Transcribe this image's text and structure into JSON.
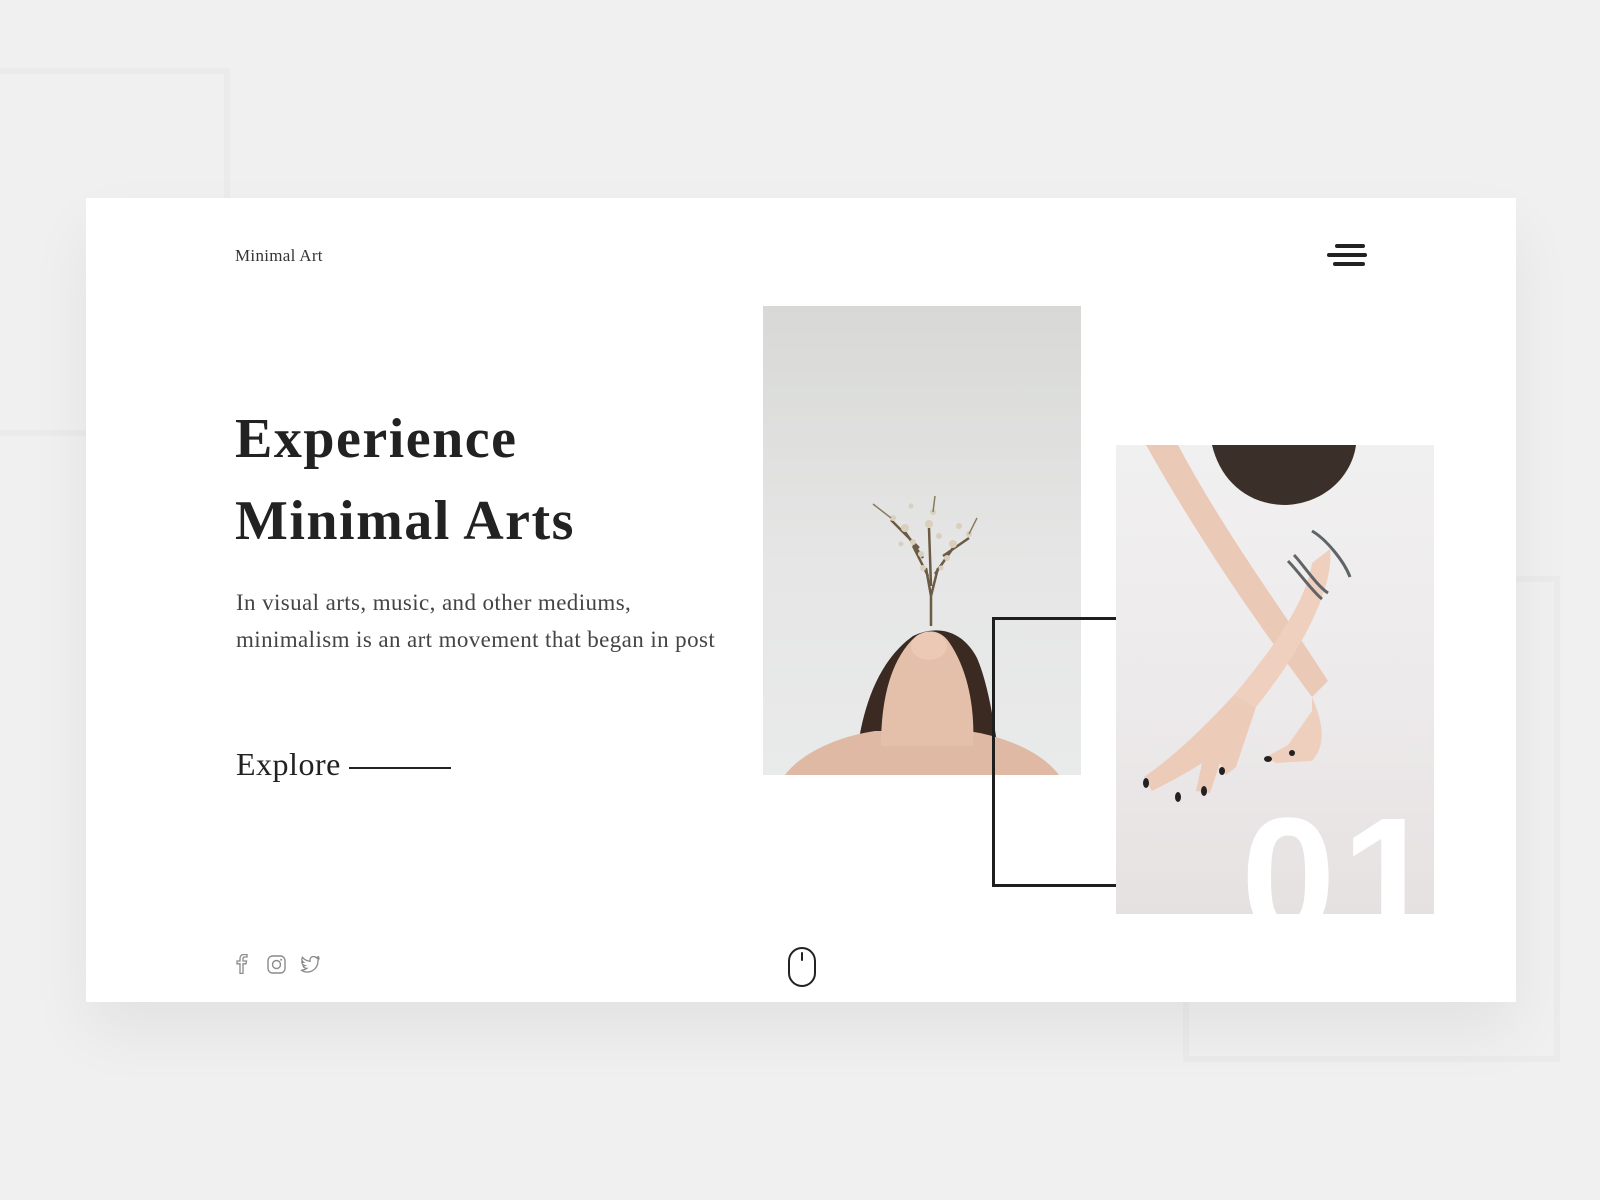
{
  "header": {
    "brand": "Minimal Art"
  },
  "hero": {
    "headline_line1": "Experience",
    "headline_line2": "Minimal Arts",
    "description": "In visual arts, music, and other mediums, minimalism is an art movement that began in post",
    "cta_label": "Explore"
  },
  "gallery": {
    "slide_number": "01"
  },
  "icons": {
    "menu": "hamburger-menu-icon",
    "facebook": "facebook-icon",
    "instagram": "instagram-icon",
    "twitter": "twitter-icon",
    "scroll": "mouse-scroll-icon"
  },
  "colors": {
    "background": "#f0f0f0",
    "card": "#ffffff",
    "text": "#222222",
    "social_icon": "#8a8a8a"
  }
}
